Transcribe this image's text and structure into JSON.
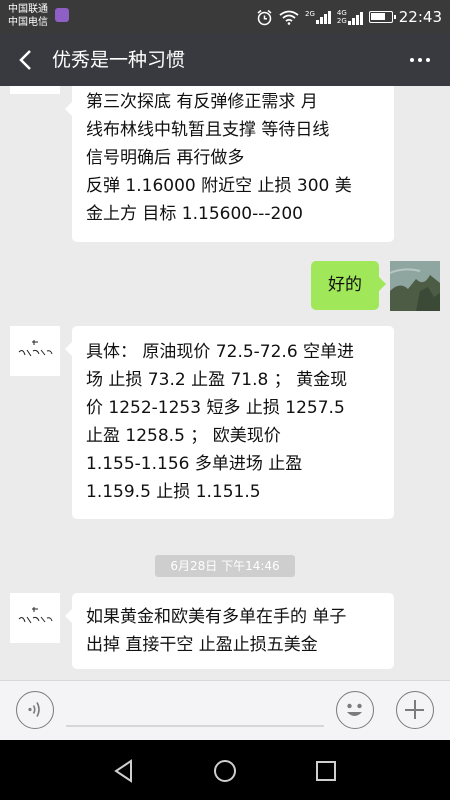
{
  "status_bar": {
    "carrier_1": "中国联通",
    "carrier_2": "中国电信",
    "network_1": "2G",
    "network_2": "4G",
    "network_3": "2G",
    "time": "22:43"
  },
  "header": {
    "title": "优秀是一种习惯"
  },
  "messages": [
    {
      "side": "left",
      "lines": [
        "第三次探底 有反弹修正需求 月",
        "线布林线中轨暂且支撑 等待日线",
        "信号明确后 再行做多",
        "反弹 1.16000 附近空 止损 300 美",
        "金上方 目标 1.15600---200"
      ]
    },
    {
      "side": "right",
      "lines": [
        "好的"
      ]
    },
    {
      "side": "left",
      "lines": [
        "具体： 原油现价 72.5-72.6 空单进",
        "场 止损 73.2 止盈 71.8 ； 黄金现",
        "价 1252-1253 短多 止损 1257.5",
        "止盈 1258.5 ； 欧美现价",
        "1.155-1.156 多单进场 止盈",
        "1.159.5 止损 1.151.5"
      ]
    },
    {
      "side": "left",
      "lines": [
        "如果黄金和欧美有多单在手的 单子",
        "出掉 直接干空 止盈止损五美金"
      ]
    }
  ],
  "timestamp": "6月28日 下午14:46",
  "input": {
    "value": "",
    "placeholder": ""
  },
  "icons": {
    "back": "back-arrow-icon",
    "more": "more-dots-icon",
    "voice": "voice-icon",
    "emoji": "emoji-icon",
    "plus": "plus-icon",
    "nav_back": "nav-back-icon",
    "nav_home": "nav-home-icon",
    "nav_recent": "nav-recent-icon"
  },
  "colors": {
    "title_bar": "#393a3f",
    "status_bar": "#3a3a3a",
    "chat_bg": "#ebebeb",
    "bubble_self": "#a0e75a",
    "bubble_other": "#ffffff",
    "timestamp_bg": "#cecece"
  }
}
